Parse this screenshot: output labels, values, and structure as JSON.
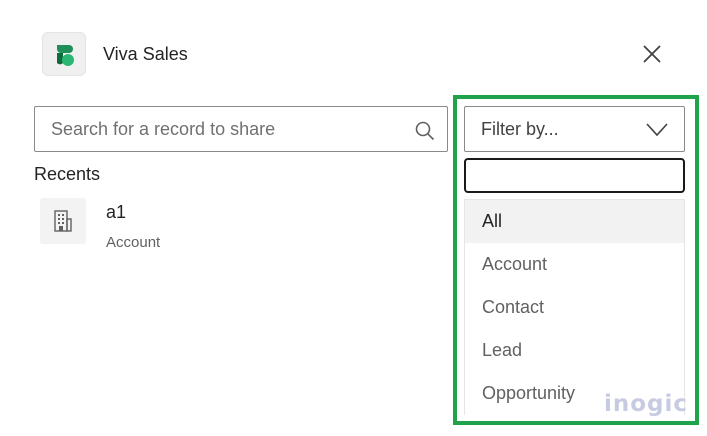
{
  "header": {
    "app_name": "Viva Sales",
    "app_icon": "viva-sales-logo",
    "close_icon": "close-icon"
  },
  "search": {
    "placeholder": "Search for a record to share",
    "value": "",
    "icon": "search-icon"
  },
  "recents": {
    "label": "Recents",
    "items": [
      {
        "name": "a1",
        "type": "Account",
        "icon": "building-icon"
      }
    ]
  },
  "filter": {
    "label": "Filter by...",
    "search_value": "",
    "options": [
      {
        "label": "All",
        "selected": true
      },
      {
        "label": "Account",
        "selected": false
      },
      {
        "label": "Contact",
        "selected": false
      },
      {
        "label": "Lead",
        "selected": false
      },
      {
        "label": "Opportunity",
        "selected": false
      }
    ]
  },
  "colors": {
    "highlight": "#1fa34a",
    "logo_dark": "#0e6b3f",
    "logo_light": "#2bb673"
  },
  "watermark": {
    "text": "inogic"
  }
}
